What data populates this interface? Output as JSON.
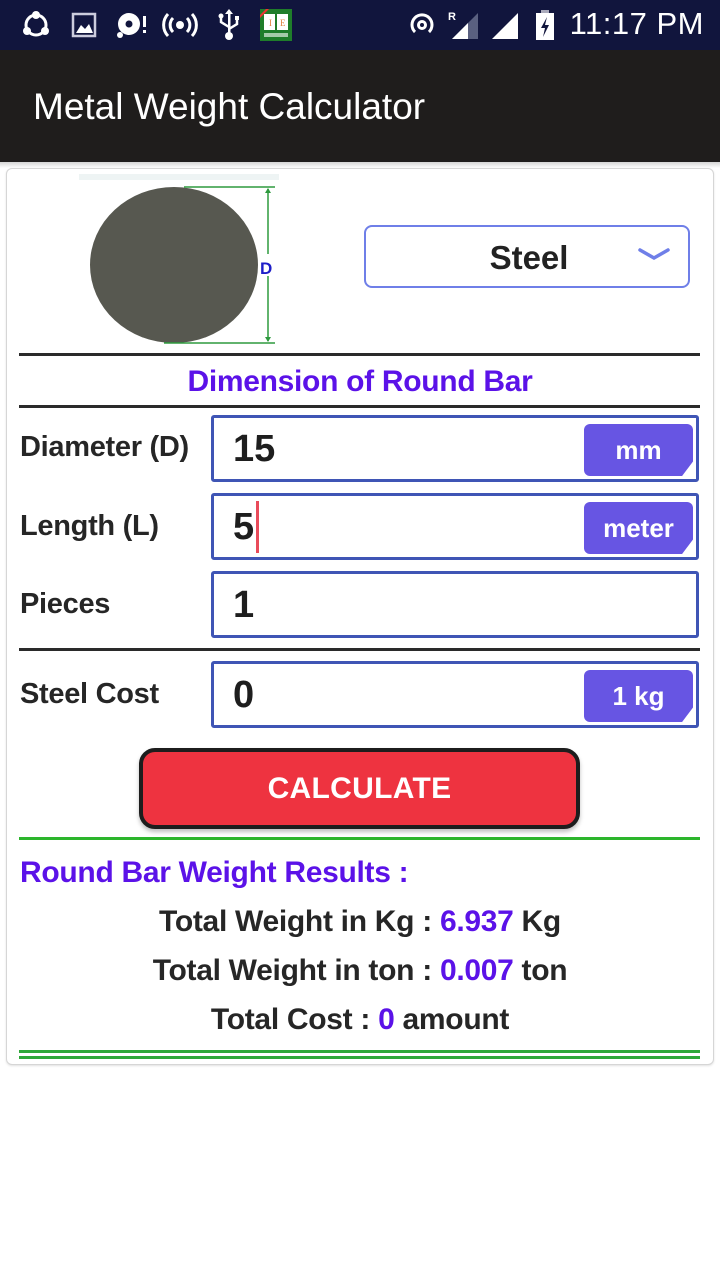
{
  "status_bar": {
    "time": "11:17 PM",
    "icons": [
      "sync-share-icon",
      "image-icon",
      "disc-alert-icon",
      "hotspot-broadcast-icon",
      "usb-icon",
      "dictionary-app-icon",
      "wifi-hotspot-icon",
      "roaming-signal-icon",
      "signal-icon",
      "battery-charging-icon"
    ],
    "roaming_label": "R"
  },
  "app_bar": {
    "title": "Metal Weight Calculator"
  },
  "shape": {
    "name": "round-bar",
    "dimension_label": "D"
  },
  "material_select": {
    "value": "Steel"
  },
  "section_title": "Dimension of Round Bar",
  "fields": [
    {
      "label": "Diameter (D)",
      "value": "15",
      "unit": "mm"
    },
    {
      "label": "Length (L)",
      "value": "5",
      "unit": "meter"
    },
    {
      "label": "Pieces",
      "value": "1",
      "unit": ""
    },
    {
      "label": "Steel Cost",
      "value": "0",
      "unit": "1 kg"
    }
  ],
  "calculate_button": "CALCULATE",
  "results": {
    "title": "Round Bar Weight Results :",
    "lines": [
      {
        "prefix": "Total Weight in Kg : ",
        "value": "6.937",
        "suffix": " Kg"
      },
      {
        "prefix": "Total Weight in ton : ",
        "value": "0.007",
        "suffix": " ton"
      },
      {
        "prefix": "Total Cost : ",
        "value": "0",
        "suffix": " amount"
      }
    ]
  },
  "colors": {
    "accent_purple": "#5b12e8",
    "badge_purple": "#6755e3",
    "input_border": "#3f55b5",
    "button_red": "#ee3340",
    "divider_green": "#2cb52c",
    "status_bar": "#11153d",
    "app_bar": "#1f1d1c"
  }
}
